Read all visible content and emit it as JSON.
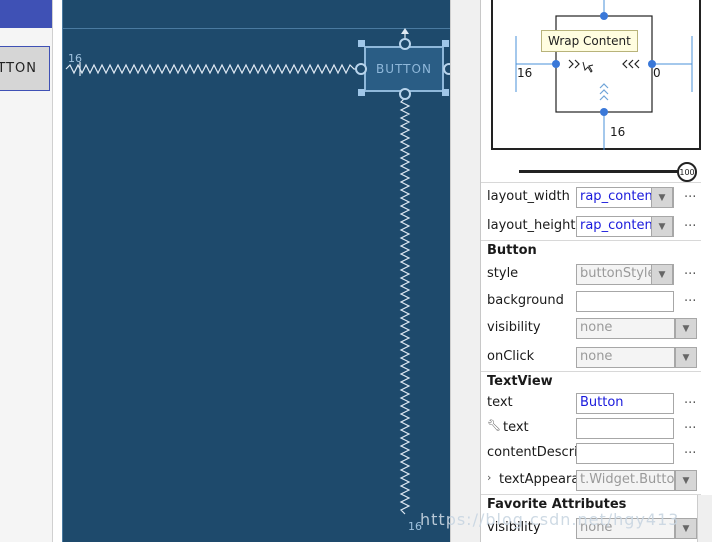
{
  "preview": {
    "button_text": "TTON"
  },
  "blueprint": {
    "button_text": "BUTTON",
    "margin_left_label": "16",
    "margin_bottom_label": "16"
  },
  "inspector": {
    "tooltip": "Wrap Content",
    "left_margin": "16",
    "right_margin": "0",
    "bottom_margin": "16",
    "bias_value": "100"
  },
  "attributes": {
    "layout_width": {
      "label": "layout_width",
      "value": "rap_content"
    },
    "layout_height": {
      "label": "layout_height",
      "value": "rap_content"
    },
    "section_button": "Button",
    "style": {
      "label": "style",
      "value": "buttonStyle"
    },
    "background": {
      "label": "background",
      "value": ""
    },
    "visibility": {
      "label": "visibility",
      "value": "none"
    },
    "onclick": {
      "label": "onClick",
      "value": "none"
    },
    "section_textview": "TextView",
    "text": {
      "label": "text",
      "value": "Button"
    },
    "text_tools": {
      "label": "text",
      "value": ""
    },
    "content_description": {
      "label": "contentDescrip",
      "value": ""
    },
    "text_appearance": {
      "label": "textAppeara",
      "value": "t.Widget.Button"
    },
    "section_favorite": "Favorite Attributes",
    "fav_visibility": {
      "label": "visibility",
      "value": "none"
    },
    "more": "..."
  },
  "watermark": "https://blog.csdn.net/hgy413"
}
